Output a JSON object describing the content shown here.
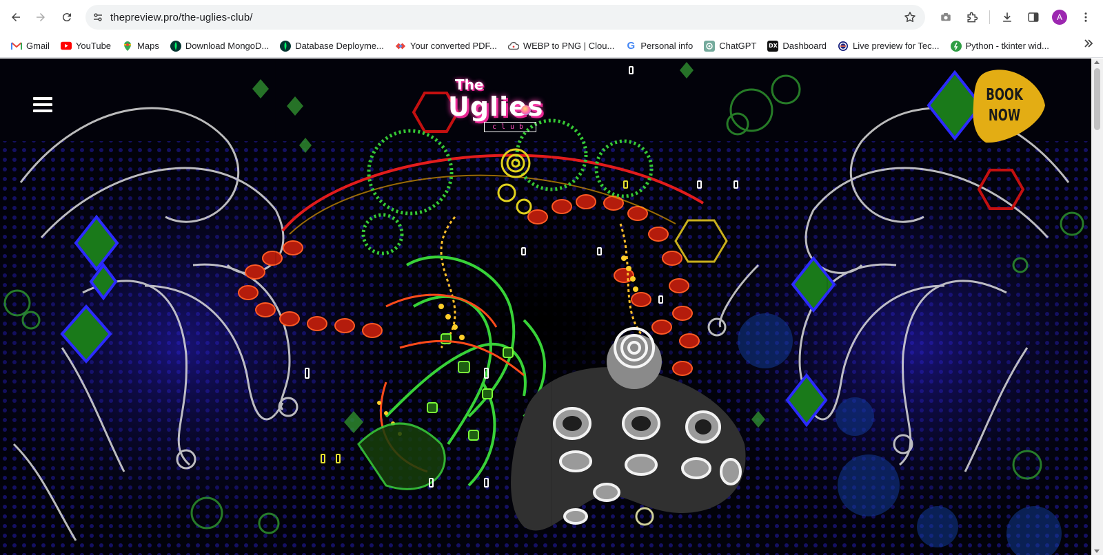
{
  "browser": {
    "url": "thepreview.pro/the-uglies-club/",
    "profile_initial": "A",
    "icons": {
      "back": "back-arrow-icon",
      "forward": "forward-arrow-icon",
      "reload": "reload-icon",
      "site_info": "tune-icon",
      "bookmark_star": "star-icon",
      "screenshot": "camera-icon",
      "extensions": "puzzle-icon",
      "downloads": "download-icon",
      "side_panel": "side-panel-icon",
      "menu": "kebab-menu-icon",
      "more_bookmarks": "double-chevron-icon"
    },
    "colors": {
      "avatar": "#9c27b0",
      "omnibox": "#f1f3f4"
    }
  },
  "bookmarks": [
    {
      "label": "Gmail",
      "icon": "gmail-icon"
    },
    {
      "label": "YouTube",
      "icon": "youtube-icon"
    },
    {
      "label": "Maps",
      "icon": "maps-icon"
    },
    {
      "label": "Download MongoD...",
      "icon": "mongodb-icon"
    },
    {
      "label": "Database Deployme...",
      "icon": "mongodb-icon"
    },
    {
      "label": "Your converted PDF...",
      "icon": "pdf-converter-icon"
    },
    {
      "label": "WEBP to PNG | Clou...",
      "icon": "cloud-icon"
    },
    {
      "label": "Personal info",
      "icon": "google-icon"
    },
    {
      "label": "ChatGPT",
      "icon": "chatgpt-icon"
    },
    {
      "label": "Dashboard",
      "icon": "dx-icon"
    },
    {
      "label": "Live preview for Tec...",
      "icon": "globe-icon"
    },
    {
      "label": "Python - tkinter wid...",
      "icon": "python-icon"
    }
  ],
  "site": {
    "logo": {
      "top": "The",
      "main": "Uglies",
      "sub": "club"
    },
    "book_now": {
      "line1": "BOOK",
      "line2": "NOW",
      "color": "#e3ad14"
    },
    "hamburger_icon": "hamburger-menu-icon",
    "hero_background": "#02020a"
  }
}
